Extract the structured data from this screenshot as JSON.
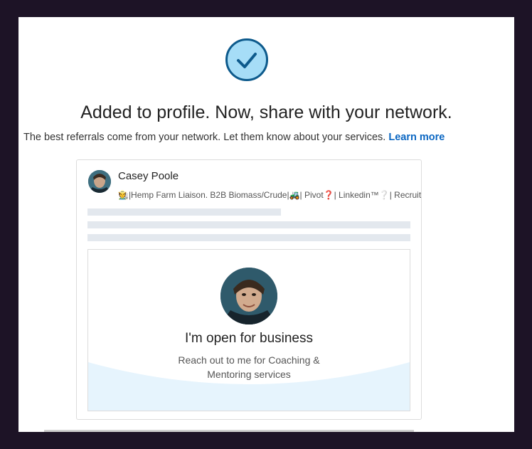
{
  "modal": {
    "title": "Added to profile. Now, share with your network.",
    "subtitle": "The best referrals come from your network. Let them know about your services.",
    "learn_more": "Learn more"
  },
  "post_preview": {
    "author_name": "Casey Poole",
    "author_headline": "🧑‍🌾|Hemp Farm Liaison. B2B Biomass/Crude|🚜| Pivot❓| Linkedin™❔| Recruiters❓| Guarantee",
    "open_for_business": {
      "title": "I'm open for business",
      "description": "Reach out to me for Coaching & Mentoring services"
    }
  },
  "colors": {
    "backdrop": "#1d1326",
    "check_badge_fill": "#a6ddf7",
    "check_badge_stroke": "#0d5a8c",
    "link": "#0a66c2",
    "wave": "#e6f4fd"
  }
}
